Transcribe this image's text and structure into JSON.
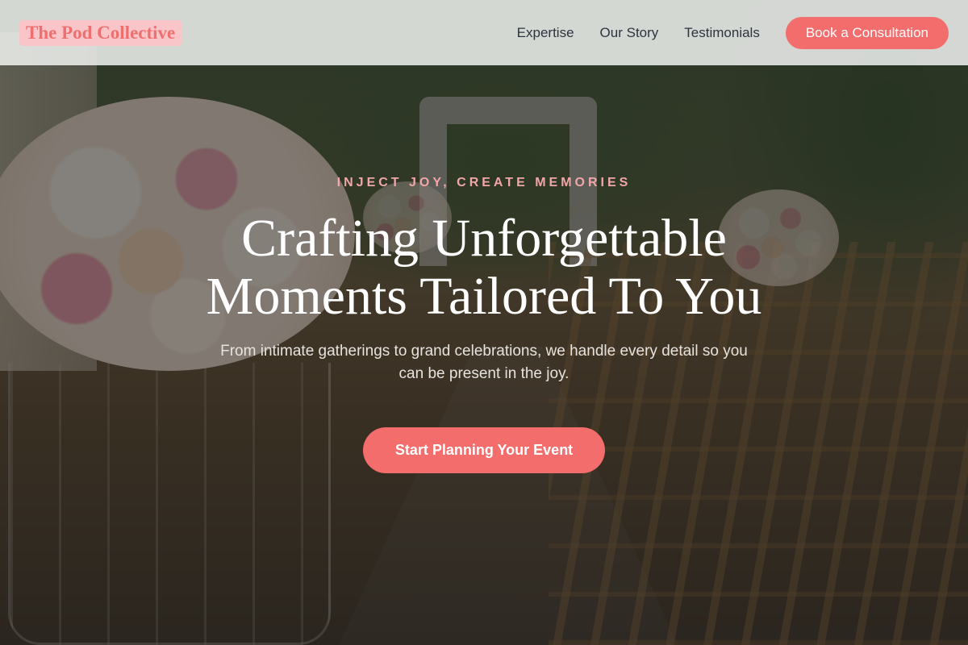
{
  "brand": {
    "name": "The Pod Collective"
  },
  "nav": {
    "links": [
      "Expertise",
      "Our Story",
      "Testimonials"
    ],
    "cta_label": "Book a Consultation"
  },
  "hero": {
    "eyebrow": "INJECT JOY, CREATE MEMORIES",
    "headline_line1": "Crafting Unforgettable",
    "headline_line2": "Moments Tailored To You",
    "subtext": "From intimate gatherings to grand celebrations, we handle every detail so you can be present in the joy.",
    "cta_label": "Start Planning Your Event"
  },
  "colors": {
    "accent": "#f46d6d",
    "logo_bg": "#f9c5c9",
    "eyebrow": "#f2a6a8",
    "nav_text": "#2d3440"
  }
}
